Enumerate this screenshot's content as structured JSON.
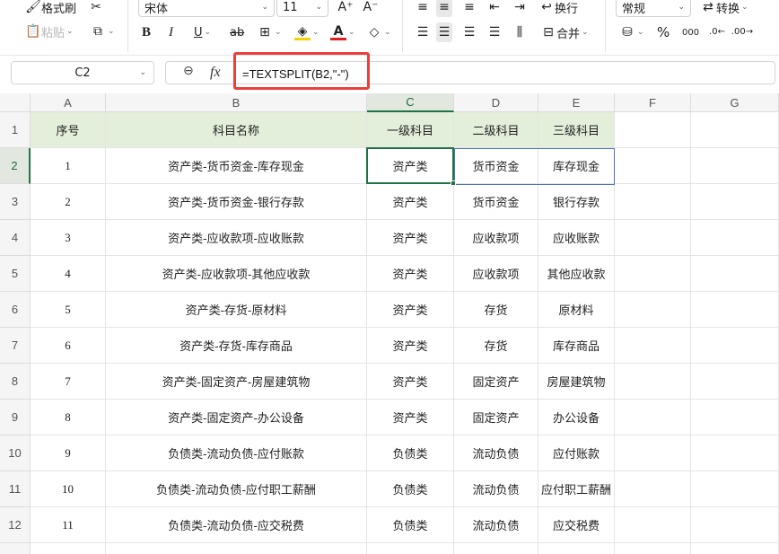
{
  "toolbar": {
    "format_painter": "格式刷",
    "paste": "粘贴",
    "font_name": "宋体",
    "font_size": "11",
    "bold": "B",
    "italic": "I",
    "underline": "U",
    "strike": "ab",
    "convert": "换行",
    "merge": "合并",
    "number_format": "常规",
    "transform": "转换",
    "percent": "%",
    "thousands": "000"
  },
  "formula_bar": {
    "cell_ref": "C2",
    "fx": "fx",
    "formula": "=TEXTSPLIT(B2,\"-\")"
  },
  "columns": [
    "A",
    "B",
    "C",
    "D",
    "E",
    "F",
    "G"
  ],
  "active_column": "C",
  "active_row": "2",
  "header_row": {
    "row": "1",
    "cells": [
      "序号",
      "科目名称",
      "一级科目",
      "二级科目",
      "三级科目"
    ]
  },
  "rows": [
    {
      "row": "2",
      "cells": [
        "1",
        "资产类-货币资金-库存现金",
        "资产类",
        "货币资金",
        "库存现金"
      ]
    },
    {
      "row": "3",
      "cells": [
        "2",
        "资产类-货币资金-银行存款",
        "资产类",
        "货币资金",
        "银行存款"
      ]
    },
    {
      "row": "4",
      "cells": [
        "3",
        "资产类-应收款项-应收账款",
        "资产类",
        "应收款项",
        "应收账款"
      ]
    },
    {
      "row": "5",
      "cells": [
        "4",
        "资产类-应收款项-其他应收款",
        "资产类",
        "应收款项",
        "其他应收款"
      ]
    },
    {
      "row": "6",
      "cells": [
        "5",
        "资产类-存货-原材料",
        "资产类",
        "存货",
        "原材料"
      ]
    },
    {
      "row": "7",
      "cells": [
        "6",
        "资产类-存货-库存商品",
        "资产类",
        "存货",
        "库存商品"
      ]
    },
    {
      "row": "8",
      "cells": [
        "7",
        "资产类-固定资产-房屋建筑物",
        "资产类",
        "固定资产",
        "房屋建筑物"
      ]
    },
    {
      "row": "9",
      "cells": [
        "8",
        "资产类-固定资产-办公设备",
        "资产类",
        "固定资产",
        "办公设备"
      ]
    },
    {
      "row": "10",
      "cells": [
        "9",
        "负债类-流动负债-应付账款",
        "负债类",
        "流动负债",
        "应付账款"
      ]
    },
    {
      "row": "11",
      "cells": [
        "10",
        "负债类-流动负债-应付职工薪酬",
        "负债类",
        "流动负债",
        "应付职工薪酬"
      ]
    },
    {
      "row": "12",
      "cells": [
        "11",
        "负债类-流动负债-应交税费",
        "负债类",
        "流动负债",
        "应交税费"
      ]
    },
    {
      "row": "13",
      "cells": [
        "",
        "",
        "",
        "",
        ""
      ]
    }
  ],
  "colors": {
    "header_fill": "#e3efda",
    "selection": "#217346",
    "spill_border": "#4a72c4",
    "highlight_box": "#e8403b"
  }
}
